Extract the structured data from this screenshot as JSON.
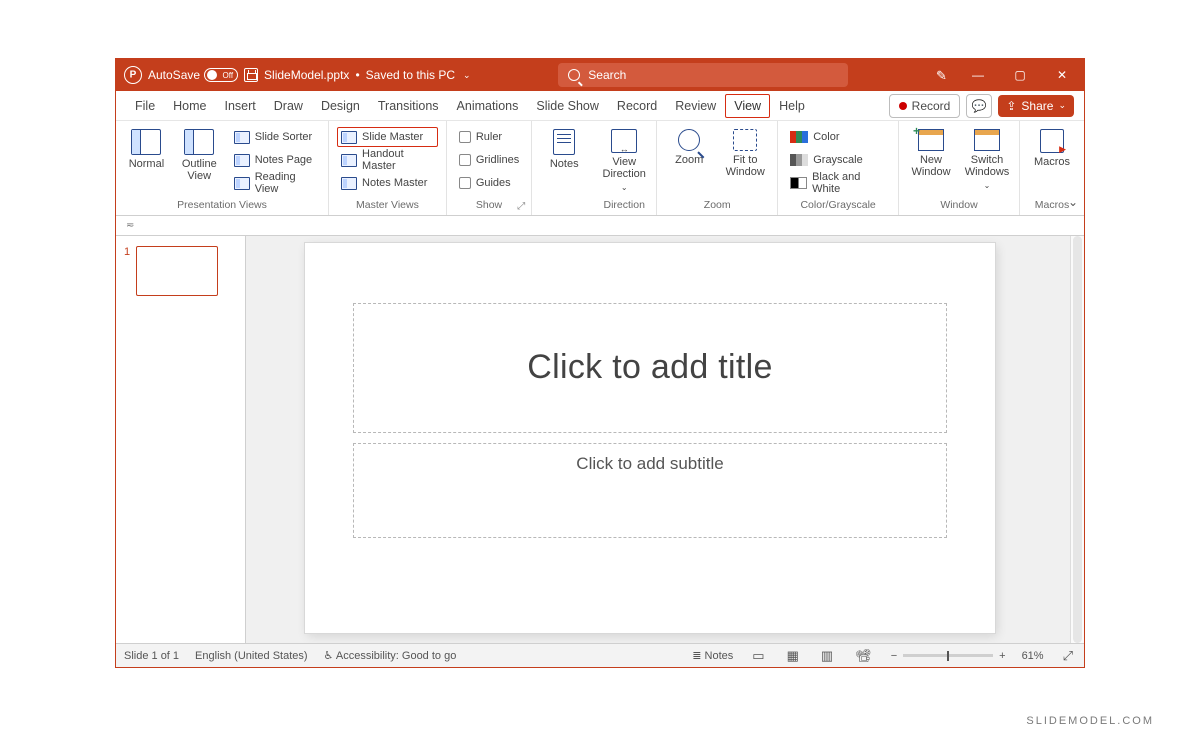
{
  "titlebar": {
    "autosave_label": "AutoSave",
    "autosave_state": "Off",
    "filename": "SlideModel.pptx",
    "save_state": "Saved to this PC",
    "search_placeholder": "Search"
  },
  "tabs": [
    "File",
    "Home",
    "Insert",
    "Draw",
    "Design",
    "Transitions",
    "Animations",
    "Slide Show",
    "Record",
    "Review",
    "View",
    "Help"
  ],
  "active_tab": "View",
  "titlebuttons": {
    "record": "Record",
    "share": "Share"
  },
  "ribbon": {
    "presentation_views": {
      "label": "Presentation Views",
      "normal": "Normal",
      "outline": "Outline\nView",
      "slide_sorter": "Slide Sorter",
      "notes_page": "Notes Page",
      "reading_view": "Reading View"
    },
    "master_views": {
      "label": "Master Views",
      "slide_master": "Slide Master",
      "handout_master": "Handout Master",
      "notes_master": "Notes Master"
    },
    "show": {
      "label": "Show",
      "ruler": "Ruler",
      "gridlines": "Gridlines",
      "guides": "Guides"
    },
    "notes": "Notes",
    "direction": {
      "label": "Direction",
      "view_direction": "View\nDirection"
    },
    "zoom": {
      "label": "Zoom",
      "zoom": "Zoom",
      "fit": "Fit to\nWindow"
    },
    "color": {
      "label": "Color/Grayscale",
      "color": "Color",
      "grayscale": "Grayscale",
      "bw": "Black and White"
    },
    "window": {
      "label": "Window",
      "new": "New\nWindow",
      "switch": "Switch\nWindows"
    },
    "macros": {
      "label": "Macros",
      "macros": "Macros"
    }
  },
  "slide": {
    "number": "1",
    "title_ph": "Click to add title",
    "subtitle_ph": "Click to add subtitle"
  },
  "statusbar": {
    "slide_of": "Slide 1 of 1",
    "lang": "English (United States)",
    "a11y": "Accessibility: Good to go",
    "notes": "Notes",
    "zoom": "61%"
  },
  "watermark": "SLIDEMODEL.COM"
}
